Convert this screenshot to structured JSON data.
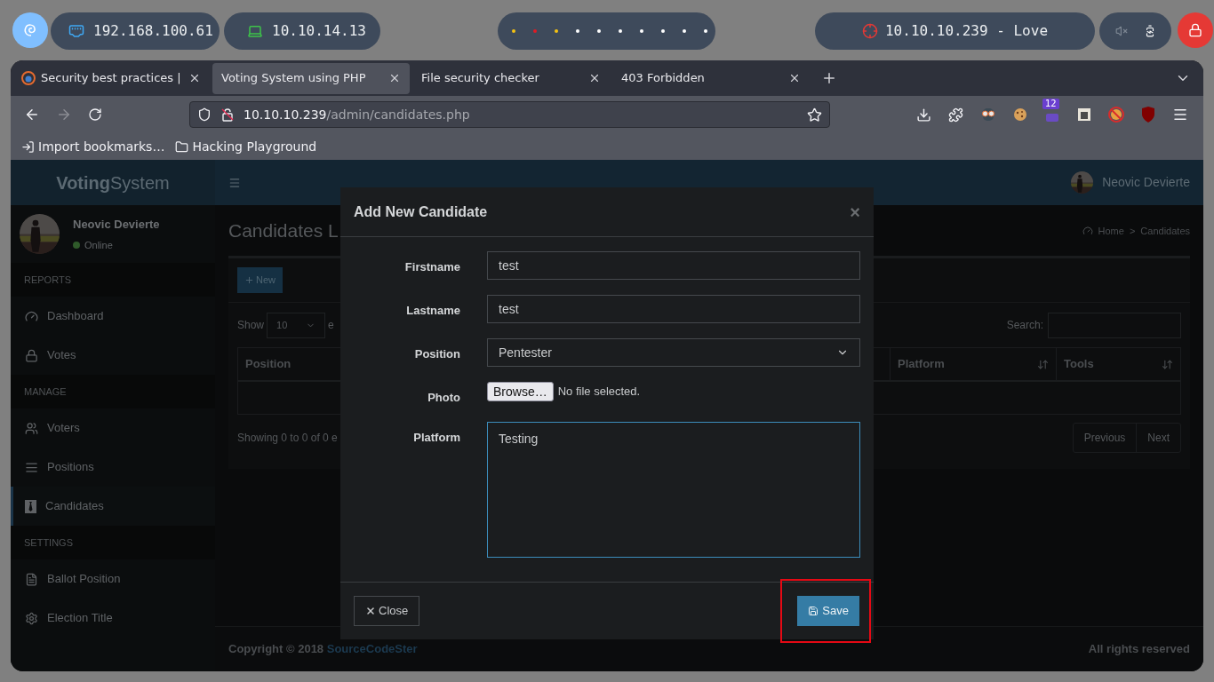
{
  "system_bar": {
    "local_ip": "192.168.100.61",
    "vpn_ip": "10.10.14.13",
    "workspaces": [
      {
        "color": "#f5c211"
      },
      {
        "color": "#e01b24"
      },
      {
        "color": "#f5c211"
      },
      {
        "color": "#ffffff"
      },
      {
        "color": "#ffffff"
      },
      {
        "color": "#ffffff"
      },
      {
        "color": "#ffffff"
      },
      {
        "color": "#ffffff"
      },
      {
        "color": "#ffffff"
      },
      {
        "color": "#ffffff"
      }
    ],
    "target": "10.10.10.239 - Love"
  },
  "browser": {
    "tabs": [
      {
        "title": "Security best practices |",
        "selected": false
      },
      {
        "title": "Voting System using PHP",
        "selected": true
      },
      {
        "title": "File security checker",
        "selected": false
      },
      {
        "title": "403 Forbidden",
        "selected": false
      }
    ],
    "forward_disabled": true,
    "url": {
      "host": "10.10.10.239",
      "path": "/admin/candidates.php"
    },
    "extension_badge": "12",
    "bookmarks": [
      {
        "label": "Import bookmarks…",
        "kind": "import"
      },
      {
        "label": "Hacking Playground",
        "kind": "folder"
      }
    ]
  },
  "app": {
    "logo": "**Voting**System",
    "header_user": "Neovic Devierte",
    "sidebar": {
      "user": {
        "name": "Neovic Devierte",
        "status": "Online"
      },
      "sections": [
        {
          "header": "REPORTS",
          "items": [
            {
              "label": "Dashboard",
              "kind": "dashboard",
              "selected": false
            },
            {
              "label": "Votes",
              "kind": "lock",
              "selected": false
            }
          ]
        },
        {
          "header": "MANAGE",
          "items": [
            {
              "label": "Voters",
              "kind": "users",
              "selected": false
            },
            {
              "label": "Positions",
              "kind": "list",
              "selected": false
            },
            {
              "label": "Candidates",
              "kind": "tie",
              "selected": true
            }
          ]
        },
        {
          "header": "SETTINGS",
          "items": [
            {
              "label": "Ballot Position",
              "kind": "file",
              "selected": false
            },
            {
              "label": "Election Title",
              "kind": "cog",
              "selected": false
            }
          ]
        }
      ]
    },
    "content": {
      "title": "Candidates L",
      "breadcrumb": {
        "items": [
          "Home",
          "Candidates"
        ],
        "separator": ">"
      },
      "new_button": "New",
      "show_label": "Show",
      "page_size": "10",
      "after_show": "e",
      "search_label": "Search:",
      "columns": [
        "Position",
        "Platform",
        "Tools"
      ],
      "info": "Showing 0 to 0 of 0 e",
      "pagination": [
        "Previous",
        "Next"
      ]
    },
    "footer": {
      "copyright": "Copyright © 2018",
      "link": "SourceCodeSter",
      "rights": "All rights reserved"
    }
  },
  "modal": {
    "title": "Add New Candidate",
    "close_mark": "×",
    "fields": [
      {
        "label": "Firstname",
        "kind": "text",
        "value": "test"
      },
      {
        "label": "Lastname",
        "kind": "text",
        "value": "test"
      },
      {
        "label": "Position",
        "kind": "select",
        "value": "Pentester"
      },
      {
        "label": "Photo",
        "kind": "file",
        "button": "Browse…",
        "value": "No file selected."
      },
      {
        "label": "Platform",
        "kind": "textarea",
        "value": "Testing",
        "focused": true
      }
    ],
    "close_button": "Close",
    "save_button": "Save",
    "save_highlighted": true
  }
}
